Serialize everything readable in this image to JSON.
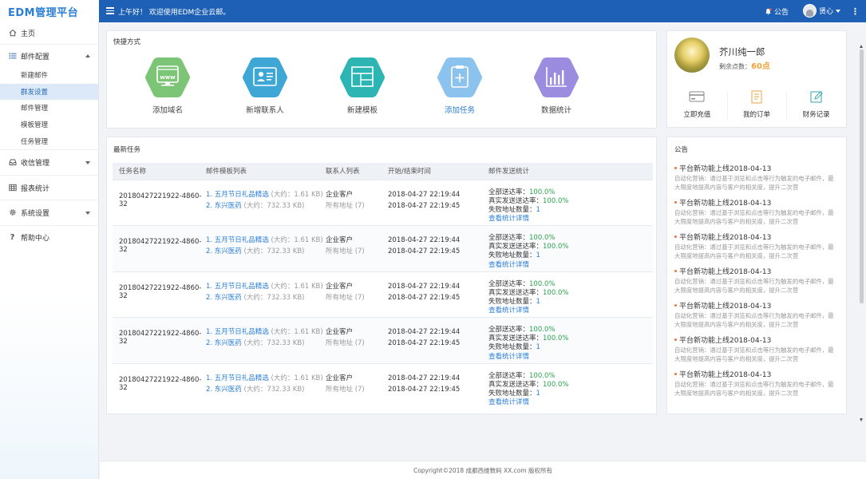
{
  "header": {
    "logo": "EDM管理平台",
    "greeting": "上午好！ 欢迎使用EDM企业云邮。",
    "notice_label": "公告",
    "user_name": "贤心",
    "more_icon": "⋮"
  },
  "sidebar": {
    "home": "主页",
    "mail_config": "邮件配置",
    "sub_items": [
      "新建邮件",
      "群发设置",
      "邮件管理",
      "模板管理",
      "任务管理"
    ],
    "active_sub": "群发设置",
    "receive": "收信管理",
    "reports": "报表统计",
    "settings": "系统设置",
    "help": "帮助中心"
  },
  "shortcuts": {
    "title": "快捷方式",
    "items": [
      {
        "label": "添加域名",
        "color": "#7cc576",
        "icon": "www-icon"
      },
      {
        "label": "新增联系人",
        "color": "#3fa7d6",
        "icon": "contact-card-icon"
      },
      {
        "label": "新建模板",
        "color": "#2cb5b3",
        "icon": "template-icon"
      },
      {
        "label": "添加任务",
        "color": "#8cc2ee",
        "icon": "clipboard-add-icon"
      },
      {
        "label": "数据统计",
        "color": "#9b8ce0",
        "icon": "bar-chart-icon"
      }
    ]
  },
  "profile": {
    "name": "芥川纯一郎",
    "points_label": "剩余点数：",
    "points_value": "60点",
    "actions": [
      "立即充值",
      "我的订单",
      "财务记录"
    ]
  },
  "tasks": {
    "title": "最新任务",
    "headers": [
      "任务名称",
      "邮件模板列表",
      "联系人列表",
      "开始/结束时间",
      "邮件发送统计"
    ],
    "rows": [
      {
        "name": "20180427221922-4860-32",
        "tpl1": "1. 五月节日礼品精选",
        "tpl1_size": "(大约：1.61 KB)",
        "tpl2": "2. 东兴医药",
        "tpl2_size": "(大约：732.33 KB)",
        "contact": "企业客户",
        "contact_sub": "所有地址 (7)",
        "start": "2018-04-27 22:19:44",
        "end": "2018-04-27 22:19:45",
        "s1_label": "全部送达率：",
        "s1": "100.0%",
        "s2_label": "真实发送送达率：",
        "s2": "100.0%",
        "s3_label": "失败地址数量：",
        "s3": "1",
        "link": "查看统计详情"
      },
      {
        "name": "20180427221922-4860-32",
        "tpl1": "1. 五月节日礼品精选",
        "tpl1_size": "(大约：1.61 KB)",
        "tpl2": "2. 东兴医药",
        "tpl2_size": "(大约：732.33 KB)",
        "contact": "企业客户",
        "contact_sub": "所有地址 (7)",
        "start": "2018-04-27 22:19:44",
        "end": "2018-04-27 22:19:45",
        "s1_label": "全部送达率：",
        "s1": "100.0%",
        "s2_label": "真实发送送达率：",
        "s2": "100.0%",
        "s3_label": "失败地址数量：",
        "s3": "1",
        "link": "查看统计详情"
      },
      {
        "name": "20180427221922-4860-32",
        "tpl1": "1. 五月节日礼品精选",
        "tpl1_size": "(大约：1.61 KB)",
        "tpl2": "2. 东兴医药",
        "tpl2_size": "(大约：732.33 KB)",
        "contact": "企业客户",
        "contact_sub": "所有地址 (7)",
        "start": "2018-04-27 22:19:44",
        "end": "2018-04-27 22:19:45",
        "s1_label": "全部送达率：",
        "s1": "100.0%",
        "s2_label": "真实发送送达率：",
        "s2": "100.0%",
        "s3_label": "失败地址数量：",
        "s3": "1",
        "link": "查看统计详情"
      },
      {
        "name": "20180427221922-4860-32",
        "tpl1": "1. 五月节日礼品精选",
        "tpl1_size": "(大约：1.61 KB)",
        "tpl2": "2. 东兴医药",
        "tpl2_size": "(大约：732.33 KB)",
        "contact": "企业客户",
        "contact_sub": "所有地址 (7)",
        "start": "2018-04-27 22:19:44",
        "end": "2018-04-27 22:19:45",
        "s1_label": "全部送达率：",
        "s1": "100.0%",
        "s2_label": "真实发送送达率：",
        "s2": "100.0%",
        "s3_label": "失败地址数量：",
        "s3": "1",
        "link": "查看统计详情"
      },
      {
        "name": "20180427221922-4860-32",
        "tpl1": "1. 五月节日礼品精选",
        "tpl1_size": "(大约：1.61 KB)",
        "tpl2": "2. 东兴医药",
        "tpl2_size": "(大约：732.33 KB)",
        "contact": "企业客户",
        "contact_sub": "所有地址 (7)",
        "start": "2018-04-27 22:19:44",
        "end": "2018-04-27 22:19:45",
        "s1_label": "全部送达率：",
        "s1": "100.0%",
        "s2_label": "真实发送送达率：",
        "s2": "100.0%",
        "s3_label": "失败地址数量：",
        "s3": "1",
        "link": "查看统计详情"
      }
    ]
  },
  "announcements": {
    "title": "公告",
    "items": [
      {
        "title": "平台新功能上线2018-04-13",
        "desc1": "自动化营销：通过基于浏览和点击等行为触发的电子邮件，最",
        "desc2": "大限度地提高内容与客户的相关度，提升二次营"
      },
      {
        "title": "平台新功能上线2018-04-13",
        "desc1": "自动化营销：通过基于浏览和点击等行为触发的电子邮件，最",
        "desc2": "大限度地提高内容与客户的相关度，提升二次营"
      },
      {
        "title": "平台新功能上线2018-04-13",
        "desc1": "自动化营销：通过基于浏览和点击等行为触发的电子邮件，最",
        "desc2": "大限度地提高内容与客户的相关度，提升二次营"
      },
      {
        "title": "平台新功能上线2018-04-13",
        "desc1": "自动化营销：通过基于浏览和点击等行为触发的电子邮件，最",
        "desc2": "大限度地提高内容与客户的相关度，提升二次营"
      },
      {
        "title": "平台新功能上线2018-04-13",
        "desc1": "自动化营销：通过基于浏览和点击等行为触发的电子邮件，最",
        "desc2": "大限度地提高内容与客户的相关度，提升二次营"
      },
      {
        "title": "平台新功能上线2018-04-13",
        "desc1": "自动化营销：通过基于浏览和点击等行为触发的电子邮件，最",
        "desc2": "大限度地提高内容与客户的相关度，提升二次营"
      },
      {
        "title": "平台新功能上线2018-04-13",
        "desc1": "自动化营销：通过基于浏览和点击等行为触发的电子邮件，最",
        "desc2": "大限度地提高内容与客户的相关度，提升二次营"
      }
    ]
  },
  "footer": {
    "text": "Copyright©2018 成都西维数码 XX.com 版权所有"
  }
}
